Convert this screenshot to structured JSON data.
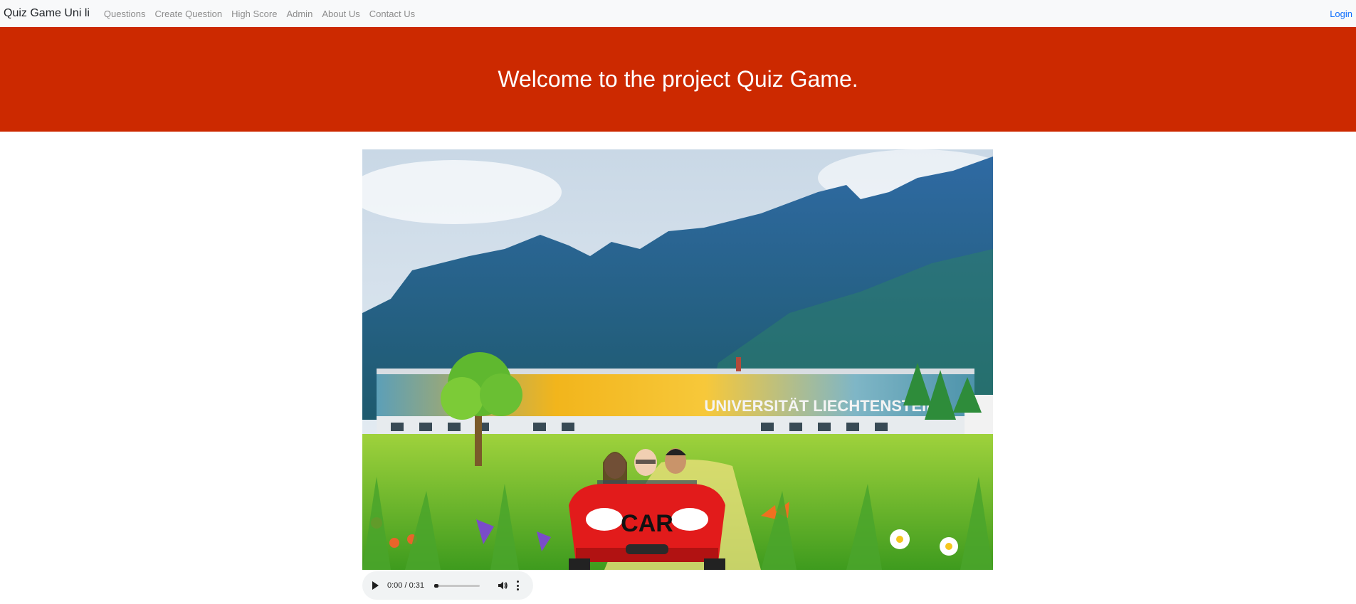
{
  "navbar": {
    "brand": "Quiz Game Uni li",
    "links": [
      "Questions",
      "Create Question",
      "High Score",
      "Admin",
      "About Us",
      "Contact Us"
    ],
    "login": "Login"
  },
  "hero": {
    "title": "Welcome to the project Quiz Game.",
    "background_color": "#cc2900"
  },
  "media": {
    "building_sign": "UNIVERSITÄT LIECHTENSTEIN",
    "car_label": "CAR"
  },
  "audio": {
    "time": "0:00 / 0:31",
    "progress": 0.0
  },
  "colors": {
    "nav_link": "#8c8c8c",
    "login": "#0d6efd",
    "hero_bg": "#cc2900"
  }
}
